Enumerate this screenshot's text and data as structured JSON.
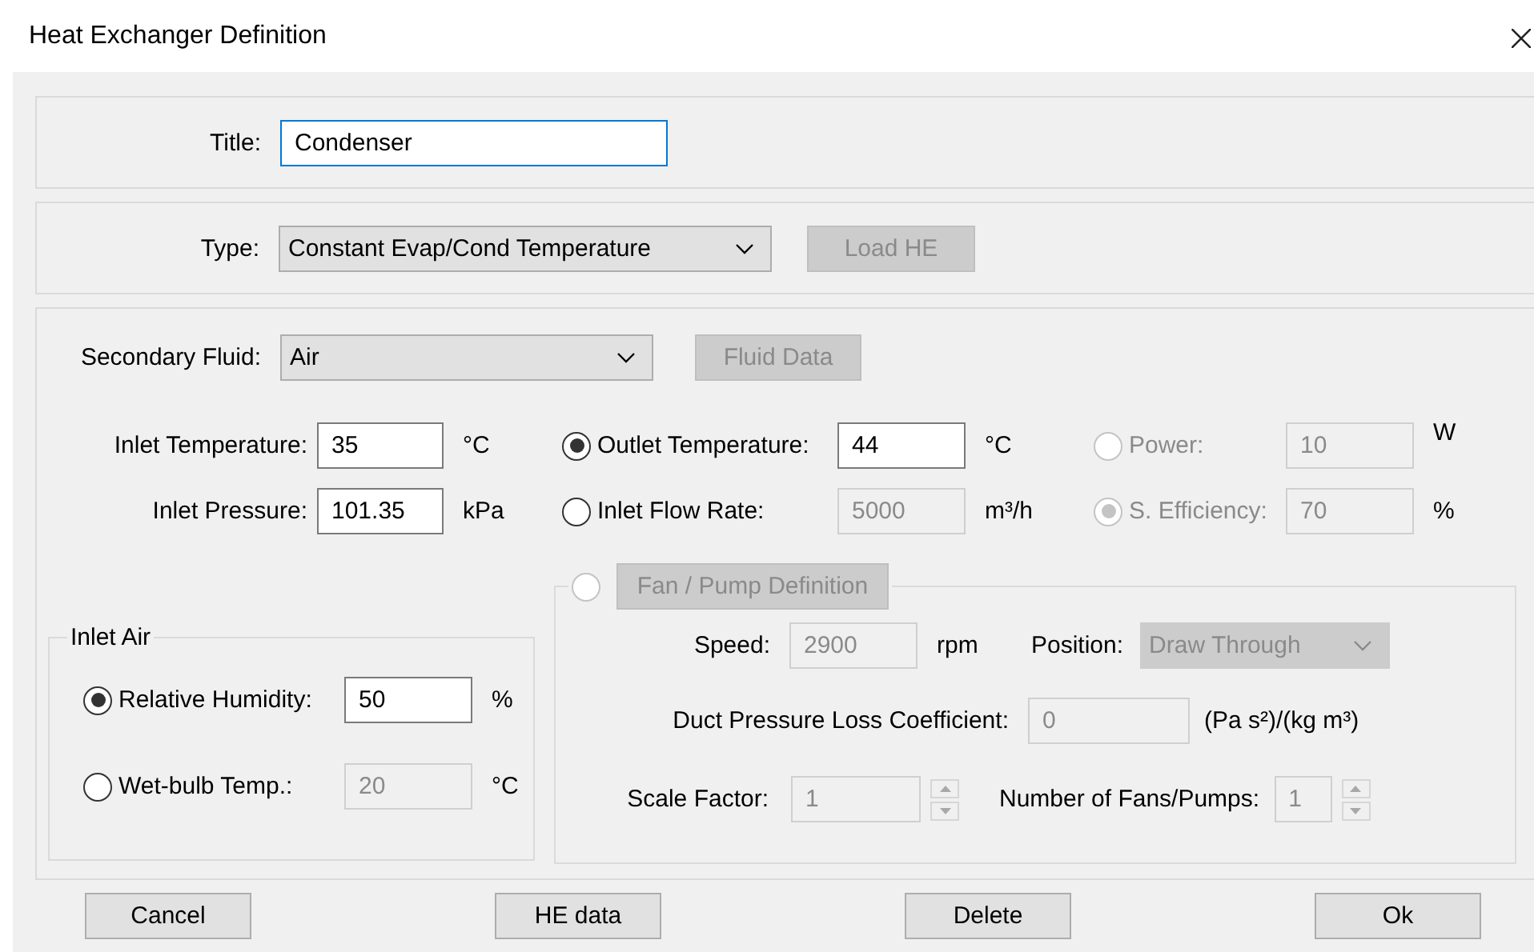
{
  "window": {
    "title": "Heat Exchanger Definition"
  },
  "title_field": {
    "label": "Title:",
    "value": "Condenser",
    "focused": true
  },
  "type_field": {
    "label": "Type:",
    "value": "Constant Evap/Cond Temperature"
  },
  "load_button": {
    "label": "Load HE",
    "disabled": true
  },
  "secondary_fluid": {
    "label": "Secondary Fluid:",
    "value": "Air"
  },
  "fluid_data_button": {
    "label": "Fluid Data",
    "disabled": true
  },
  "inlet": [
    {
      "label": "Inlet Temperature:",
      "value": "35",
      "unit": "°C"
    },
    {
      "label": "Inlet Pressure:",
      "value": "101.35",
      "unit": "kPa"
    }
  ],
  "outlet_options": [
    {
      "label": "Outlet Temperature:",
      "value": "44",
      "unit": "°C",
      "selected": true,
      "disabled": false
    },
    {
      "label": "Inlet Flow Rate:",
      "value": "5000",
      "unit": "m³/h",
      "selected": false,
      "disabled": false
    }
  ],
  "fan_options": [
    {
      "label": "Power:",
      "value": "10",
      "unit": "W",
      "selected": false,
      "disabled": true
    },
    {
      "label": "S. Efficiency:",
      "value": "70",
      "unit": "%",
      "selected": true,
      "disabled": true
    }
  ],
  "inlet_air": {
    "legend": "Inlet Air",
    "options": [
      {
        "label": "Relative Humidity:",
        "value": "50",
        "unit": "%",
        "selected": true,
        "disabled": false
      },
      {
        "label": "Wet-bulb Temp.:",
        "value": "20",
        "unit": "°C",
        "selected": false,
        "disabled": false
      }
    ]
  },
  "fan_pump": {
    "selected": false,
    "disabled": true,
    "button": "Fan / Pump Definition",
    "speed": {
      "label": "Speed:",
      "value": "2900",
      "unit": "rpm"
    },
    "position": {
      "label": "Position:",
      "value": "Draw Through"
    },
    "duct": {
      "label": "Duct Pressure Loss Coefficient:",
      "value": "0",
      "unit": "(Pa s²)/(kg m³)"
    },
    "scale": {
      "label": "Scale Factor:",
      "value": "1"
    },
    "count": {
      "label": "Number of Fans/Pumps:",
      "value": "1"
    }
  },
  "buttons": [
    "Cancel",
    "HE data",
    "Delete",
    "Ok"
  ]
}
